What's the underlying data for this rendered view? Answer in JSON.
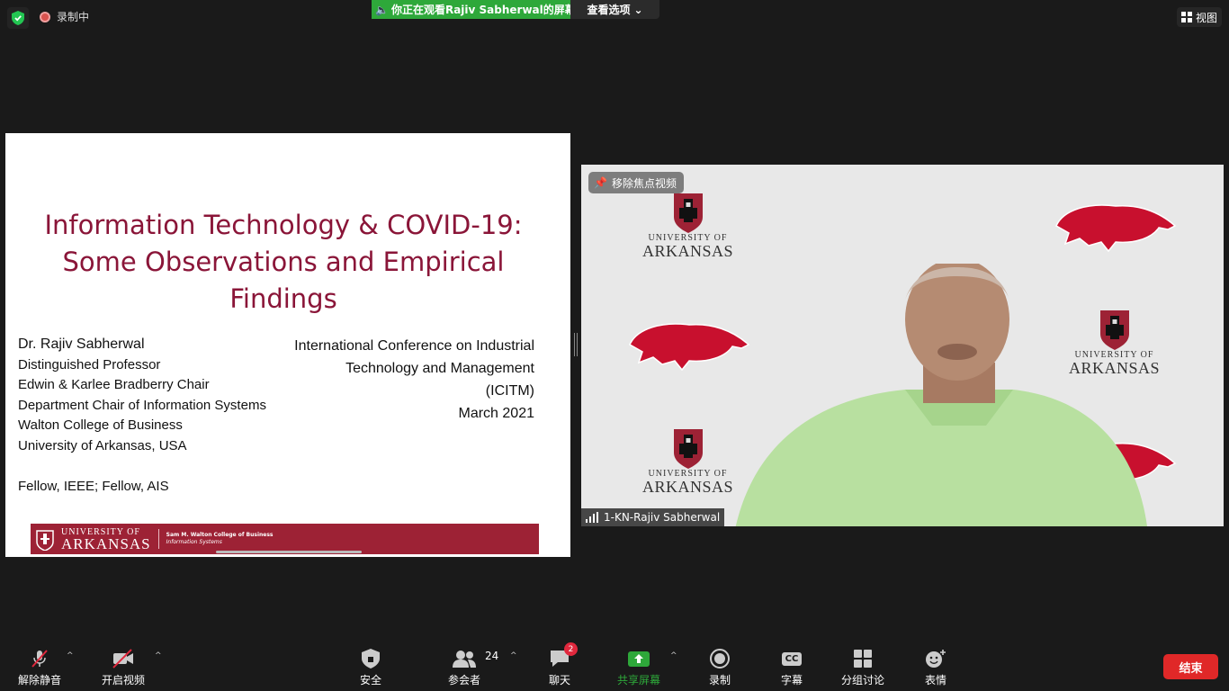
{
  "topbar": {
    "recording_label": "录制中",
    "viewing_banner": "你正在观看Rajiv  Sabherwal的屏幕",
    "view_options_label": "查看选项",
    "view_label": "视图"
  },
  "slide": {
    "title_lines": [
      "Information Technology & COVID-19:",
      "Some Observations and Empirical",
      "Findings"
    ],
    "left_lines": [
      "Dr. Rajiv Sabherwal",
      "Distinguished Professor",
      "Edwin & Karlee Bradberry Chair",
      "Department Chair of Information Systems",
      "Walton College of Business",
      "University of Arkansas, USA"
    ],
    "fellow_line": "Fellow, IEEE; Fellow, AIS",
    "right_lines": [
      "International Conference on Industrial",
      "Technology and Management",
      "(ICITM)",
      "March 2021"
    ],
    "footer": {
      "university_small": "UNIVERSITY OF",
      "university_big": "ARKANSAS",
      "college": "Sam M. Walton College of Business",
      "department": "Information Systems"
    }
  },
  "video": {
    "unpin_label": "移除焦点视频",
    "participant_name": "1-KN-Rajiv Sabherwal",
    "logo_small": "UNIVERSITY OF",
    "logo_big": "ARKANSAS"
  },
  "toolbar": {
    "unmute_label": "解除静音",
    "start_video_label": "开启视频",
    "security_label": "安全",
    "participants_label": "参会者",
    "participants_count": "24",
    "chat_label": "聊天",
    "chat_badge": "2",
    "share_label": "共享屏幕",
    "record_label": "录制",
    "cc_label": "字幕",
    "cc_icon_text": "CC",
    "breakout_label": "分组讨论",
    "reactions_label": "表情",
    "end_label": "结束"
  },
  "colors": {
    "slide_title": "#8a1538",
    "razorback_red": "#9d2235",
    "share_green": "#2ea83a",
    "end_red": "#e02828"
  }
}
